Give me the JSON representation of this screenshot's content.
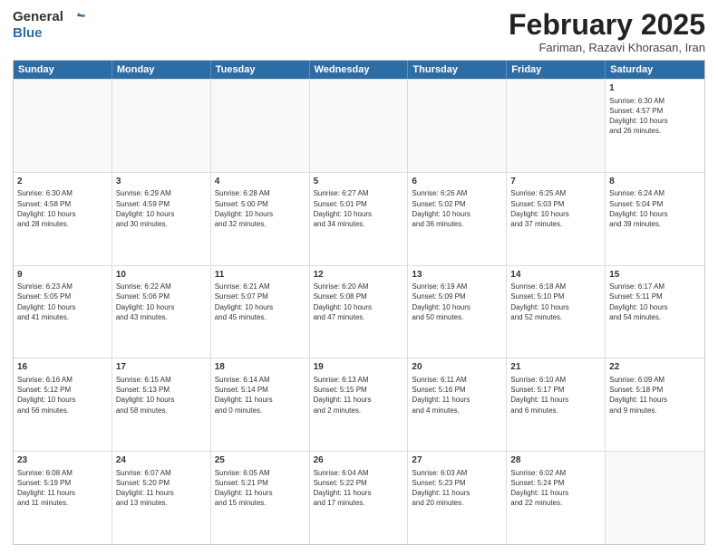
{
  "header": {
    "logo_general": "General",
    "logo_blue": "Blue",
    "month_title": "February 2025",
    "subtitle": "Fariman, Razavi Khorasan, Iran"
  },
  "weekdays": [
    "Sunday",
    "Monday",
    "Tuesday",
    "Wednesday",
    "Thursday",
    "Friday",
    "Saturday"
  ],
  "rows": [
    [
      {
        "day": "",
        "text": "",
        "empty": true
      },
      {
        "day": "",
        "text": "",
        "empty": true
      },
      {
        "day": "",
        "text": "",
        "empty": true
      },
      {
        "day": "",
        "text": "",
        "empty": true
      },
      {
        "day": "",
        "text": "",
        "empty": true
      },
      {
        "day": "",
        "text": "",
        "empty": true
      },
      {
        "day": "1",
        "text": "Sunrise: 6:30 AM\nSunset: 4:57 PM\nDaylight: 10 hours\nand 26 minutes.",
        "empty": false
      }
    ],
    [
      {
        "day": "2",
        "text": "Sunrise: 6:30 AM\nSunset: 4:58 PM\nDaylight: 10 hours\nand 28 minutes.",
        "empty": false
      },
      {
        "day": "3",
        "text": "Sunrise: 6:29 AM\nSunset: 4:59 PM\nDaylight: 10 hours\nand 30 minutes.",
        "empty": false
      },
      {
        "day": "4",
        "text": "Sunrise: 6:28 AM\nSunset: 5:00 PM\nDaylight: 10 hours\nand 32 minutes.",
        "empty": false
      },
      {
        "day": "5",
        "text": "Sunrise: 6:27 AM\nSunset: 5:01 PM\nDaylight: 10 hours\nand 34 minutes.",
        "empty": false
      },
      {
        "day": "6",
        "text": "Sunrise: 6:26 AM\nSunset: 5:02 PM\nDaylight: 10 hours\nand 36 minutes.",
        "empty": false
      },
      {
        "day": "7",
        "text": "Sunrise: 6:25 AM\nSunset: 5:03 PM\nDaylight: 10 hours\nand 37 minutes.",
        "empty": false
      },
      {
        "day": "8",
        "text": "Sunrise: 6:24 AM\nSunset: 5:04 PM\nDaylight: 10 hours\nand 39 minutes.",
        "empty": false
      }
    ],
    [
      {
        "day": "9",
        "text": "Sunrise: 6:23 AM\nSunset: 5:05 PM\nDaylight: 10 hours\nand 41 minutes.",
        "empty": false
      },
      {
        "day": "10",
        "text": "Sunrise: 6:22 AM\nSunset: 5:06 PM\nDaylight: 10 hours\nand 43 minutes.",
        "empty": false
      },
      {
        "day": "11",
        "text": "Sunrise: 6:21 AM\nSunset: 5:07 PM\nDaylight: 10 hours\nand 45 minutes.",
        "empty": false
      },
      {
        "day": "12",
        "text": "Sunrise: 6:20 AM\nSunset: 5:08 PM\nDaylight: 10 hours\nand 47 minutes.",
        "empty": false
      },
      {
        "day": "13",
        "text": "Sunrise: 6:19 AM\nSunset: 5:09 PM\nDaylight: 10 hours\nand 50 minutes.",
        "empty": false
      },
      {
        "day": "14",
        "text": "Sunrise: 6:18 AM\nSunset: 5:10 PM\nDaylight: 10 hours\nand 52 minutes.",
        "empty": false
      },
      {
        "day": "15",
        "text": "Sunrise: 6:17 AM\nSunset: 5:11 PM\nDaylight: 10 hours\nand 54 minutes.",
        "empty": false
      }
    ],
    [
      {
        "day": "16",
        "text": "Sunrise: 6:16 AM\nSunset: 5:12 PM\nDaylight: 10 hours\nand 56 minutes.",
        "empty": false
      },
      {
        "day": "17",
        "text": "Sunrise: 6:15 AM\nSunset: 5:13 PM\nDaylight: 10 hours\nand 58 minutes.",
        "empty": false
      },
      {
        "day": "18",
        "text": "Sunrise: 6:14 AM\nSunset: 5:14 PM\nDaylight: 11 hours\nand 0 minutes.",
        "empty": false
      },
      {
        "day": "19",
        "text": "Sunrise: 6:13 AM\nSunset: 5:15 PM\nDaylight: 11 hours\nand 2 minutes.",
        "empty": false
      },
      {
        "day": "20",
        "text": "Sunrise: 6:11 AM\nSunset: 5:16 PM\nDaylight: 11 hours\nand 4 minutes.",
        "empty": false
      },
      {
        "day": "21",
        "text": "Sunrise: 6:10 AM\nSunset: 5:17 PM\nDaylight: 11 hours\nand 6 minutes.",
        "empty": false
      },
      {
        "day": "22",
        "text": "Sunrise: 6:09 AM\nSunset: 5:18 PM\nDaylight: 11 hours\nand 9 minutes.",
        "empty": false
      }
    ],
    [
      {
        "day": "23",
        "text": "Sunrise: 6:08 AM\nSunset: 5:19 PM\nDaylight: 11 hours\nand 11 minutes.",
        "empty": false
      },
      {
        "day": "24",
        "text": "Sunrise: 6:07 AM\nSunset: 5:20 PM\nDaylight: 11 hours\nand 13 minutes.",
        "empty": false
      },
      {
        "day": "25",
        "text": "Sunrise: 6:05 AM\nSunset: 5:21 PM\nDaylight: 11 hours\nand 15 minutes.",
        "empty": false
      },
      {
        "day": "26",
        "text": "Sunrise: 6:04 AM\nSunset: 5:22 PM\nDaylight: 11 hours\nand 17 minutes.",
        "empty": false
      },
      {
        "day": "27",
        "text": "Sunrise: 6:03 AM\nSunset: 5:23 PM\nDaylight: 11 hours\nand 20 minutes.",
        "empty": false
      },
      {
        "day": "28",
        "text": "Sunrise: 6:02 AM\nSunset: 5:24 PM\nDaylight: 11 hours\nand 22 minutes.",
        "empty": false
      },
      {
        "day": "",
        "text": "",
        "empty": true
      }
    ]
  ]
}
